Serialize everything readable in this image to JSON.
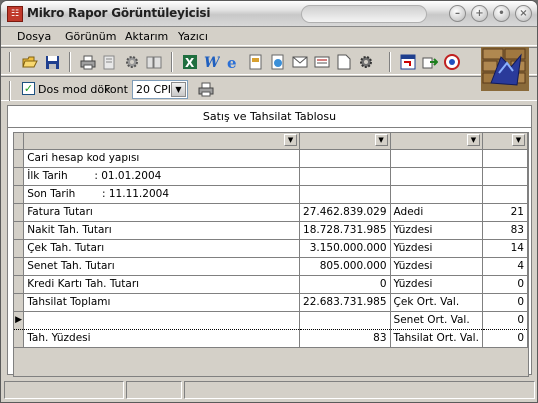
{
  "window": {
    "title": "Mikro Rapor Görüntüleyicisi",
    "app_icon": "report-app-icon"
  },
  "menu": [
    {
      "label": "Dosya"
    },
    {
      "label": "Görünüm"
    },
    {
      "label": "Aktarım"
    },
    {
      "label": "Yazıcı"
    }
  ],
  "toolbar": {
    "buttons": [
      "open-folder-icon",
      "save-icon",
      "print-icon",
      "print-preview-icon",
      "settings-gear-icon",
      "book-icon",
      "excel-icon",
      "word-icon",
      "internet-explorer-icon",
      "export-icon",
      "web-export-icon",
      "mail-icon",
      "text-export-icon",
      "page-icon",
      "gear-icon",
      "window-icon",
      "export-arrow-icon",
      "help-icon"
    ]
  },
  "options": {
    "dos_mode_label": "Dos mod dök",
    "dos_mode_checked": true,
    "font_label": "Font",
    "font_value": "20 CPI"
  },
  "report": {
    "title": "Satış ve Tahsilat Tablosu",
    "rows": [
      {
        "c1": "Cari hesap kod yapısı",
        "c2": "",
        "c3": "",
        "c4": ""
      },
      {
        "c1": "İlk Tarih        : 01.01.2004",
        "c2": "",
        "c3": "",
        "c4": ""
      },
      {
        "c1": "Son Tarih        : 11.11.2004",
        "c2": "",
        "c3": "",
        "c4": ""
      },
      {
        "c1": "Fatura Tutarı",
        "c2": "27.462.839.029",
        "c3": "Adedi",
        "c4": "21"
      },
      {
        "c1": "Nakit Tah. Tutarı",
        "c2": "18.728.731.985",
        "c3": "Yüzdesi",
        "c4": "83"
      },
      {
        "c1": "Çek Tah. Tutarı",
        "c2": "3.150.000.000",
        "c3": "Yüzdesi",
        "c4": "14"
      },
      {
        "c1": "Senet Tah. Tutarı",
        "c2": "805.000.000",
        "c3": "Yüzdesi",
        "c4": "4"
      },
      {
        "c1": "Kredi Kartı Tah. Tutarı",
        "c2": "0",
        "c3": "Yüzdesi",
        "c4": "0"
      },
      {
        "c1": "Tahsilat Toplamı",
        "c2": "22.683.731.985",
        "c3": "Çek Ort. Val.",
        "c4": "0"
      },
      {
        "c1": "",
        "c2": "",
        "c3": "Senet Ort. Val.",
        "c4": "0"
      },
      {
        "c1": "Tah. Yüzdesi",
        "c2": "83",
        "c3": "Tahsilat Ort. Val.",
        "c4": "0"
      }
    ],
    "selected_row": 9
  }
}
